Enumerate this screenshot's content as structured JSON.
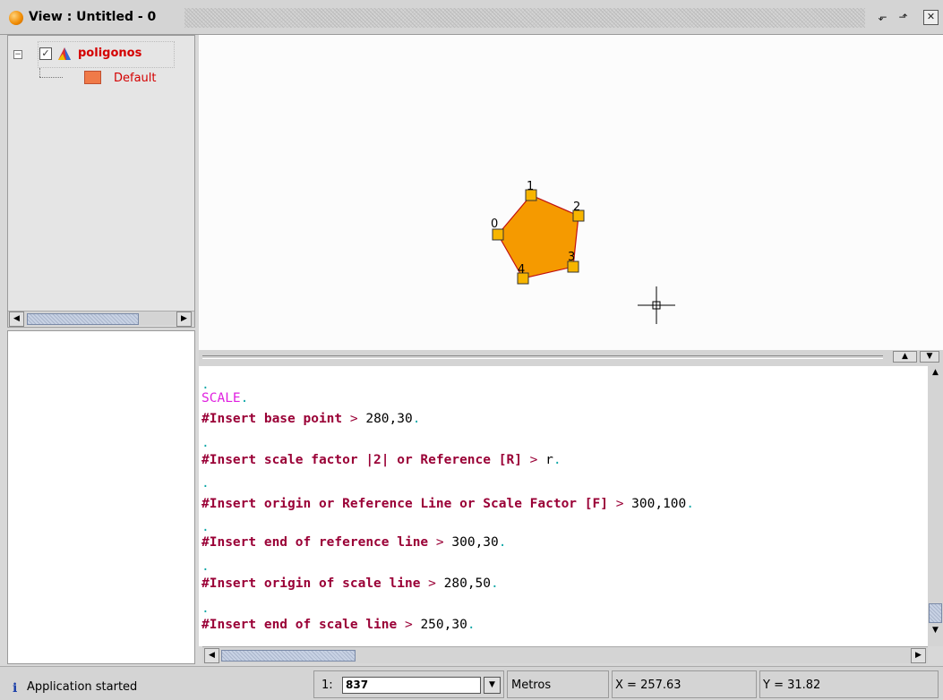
{
  "window": {
    "title": "View : Untitled - 0",
    "minimize_glyph": "⬐",
    "maximize_glyph": "⬏",
    "close_glyph": "✕"
  },
  "toc": {
    "layer_name": "poligonos",
    "layer_checked": true,
    "expander": "−",
    "legend_label": "Default",
    "legend_color": "#f07a48"
  },
  "map": {
    "fill_color": "#f59a00",
    "stroke_color": "#c01010",
    "vertex_color": "#f7b500",
    "vertex_labels": [
      "0",
      "1",
      "2",
      "3",
      "4"
    ]
  },
  "console": {
    "lines": [
      {
        "kind": "dot",
        "text": "."
      },
      {
        "kind": "cmd",
        "text": "SCALE",
        "suffix": "."
      },
      {
        "kind": "prompt",
        "text": "#Insert base point",
        "value": "280,30",
        "suffix": "."
      },
      {
        "kind": "dot",
        "text": "."
      },
      {
        "kind": "prompt",
        "text": "#Insert scale factor |2| or Reference [R]",
        "value": "r",
        "suffix": "."
      },
      {
        "kind": "dot",
        "text": "."
      },
      {
        "kind": "prompt",
        "text": "#Insert origin or Reference Line or Scale Factor [F]",
        "value": "300,100",
        "suffix": "."
      },
      {
        "kind": "dot",
        "text": "."
      },
      {
        "kind": "prompt",
        "text": "#Insert end of reference line",
        "value": "300,30",
        "suffix": "."
      },
      {
        "kind": "dot",
        "text": "."
      },
      {
        "kind": "prompt",
        "text": "#Insert origin of scale line",
        "value": "280,50",
        "suffix": "."
      },
      {
        "kind": "dot",
        "text": "."
      },
      {
        "kind": "prompt",
        "text": "#Insert end of scale line",
        "value": "250,30",
        "suffix": "."
      }
    ],
    "prompt_separator": ">"
  },
  "status": {
    "info_icon": "i",
    "message": "Application started",
    "scale_prefix": "1:",
    "scale_value": "837",
    "units": "Metros",
    "x_readout": "X = 257.63",
    "y_readout": "Y = 31.82"
  }
}
